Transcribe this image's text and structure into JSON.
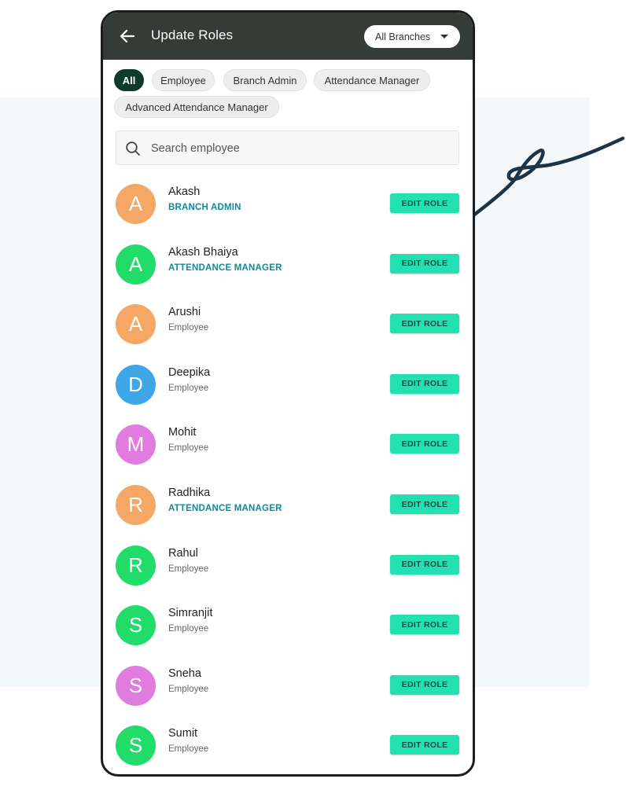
{
  "header": {
    "title": "Update Roles",
    "back_icon": "arrow-left-icon",
    "branch_select": {
      "selected": "All Branches",
      "icon": "caret-down-icon"
    }
  },
  "filters": [
    {
      "label": "All",
      "active": true
    },
    {
      "label": "Employee",
      "active": false
    },
    {
      "label": "Branch Admin",
      "active": false
    },
    {
      "label": "Attendance Manager",
      "active": false
    },
    {
      "label": "Advanced Attendance Manager",
      "active": false
    }
  ],
  "search": {
    "placeholder": "Search employee",
    "value": "",
    "icon": "search-icon"
  },
  "employees": [
    {
      "initial": "A",
      "name": "Akash",
      "role": "BRANCH ADMIN",
      "highlight": true,
      "avatar_color": "#f5a866",
      "action": "EDIT ROLE"
    },
    {
      "initial": "A",
      "name": "Akash Bhaiya",
      "role": "ATTENDANCE MANAGER",
      "highlight": true,
      "avatar_color": "#22dc6a",
      "action": "EDIT ROLE"
    },
    {
      "initial": "A",
      "name": "Arushi",
      "role": "Employee",
      "highlight": false,
      "avatar_color": "#f5a866",
      "action": "EDIT ROLE"
    },
    {
      "initial": "D",
      "name": "Deepika",
      "role": "Employee",
      "highlight": false,
      "avatar_color": "#3fa6e8",
      "action": "EDIT ROLE"
    },
    {
      "initial": "M",
      "name": "Mohit",
      "role": "Employee",
      "highlight": false,
      "avatar_color": "#e07ce0",
      "action": "EDIT ROLE"
    },
    {
      "initial": "R",
      "name": "Radhika",
      "role": "ATTENDANCE MANAGER",
      "highlight": true,
      "avatar_color": "#f5a866",
      "action": "EDIT ROLE"
    },
    {
      "initial": "R",
      "name": "Rahul",
      "role": "Employee",
      "highlight": false,
      "avatar_color": "#22dc6a",
      "action": "EDIT ROLE"
    },
    {
      "initial": "S",
      "name": "Simranjit",
      "role": "Employee",
      "highlight": false,
      "avatar_color": "#22dc6a",
      "action": "EDIT ROLE"
    },
    {
      "initial": "S",
      "name": "Sneha",
      "role": "Employee",
      "highlight": false,
      "avatar_color": "#e07ce0",
      "action": "EDIT ROLE"
    },
    {
      "initial": "S",
      "name": "Sumit",
      "role": "Employee",
      "highlight": false,
      "avatar_color": "#22dc6a",
      "action": "EDIT ROLE"
    }
  ],
  "colors": {
    "header_bg": "#353b37",
    "active_chip": "#0d3b2c",
    "edit_button": "#22e0b0",
    "role_highlight": "#0f8a9c",
    "backdrop_panel": "#f3f9fb",
    "squiggle_stroke": "#1e3344"
  }
}
